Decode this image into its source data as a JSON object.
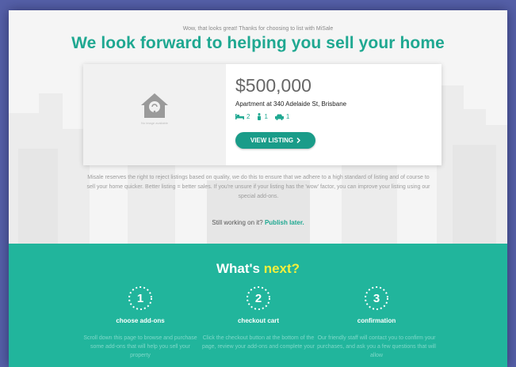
{
  "intro": "Wow, that looks great! Thanks for choosing to list with MiSale",
  "headline": "We look forward to helping you sell your home",
  "listing": {
    "image_caption": "No image available",
    "price": "$500,000",
    "address": "Apartment at 340 Adelaide St, Brisbane",
    "bedrooms": "2",
    "bathrooms": "1",
    "parking": "1",
    "view_button": "VIEW LISTING"
  },
  "disclaimer": "Misale reserves the right to reject listings based on quality, we do this to ensure that we adhere to a high standard of listing and of course to sell your home quicker. Better listing = better sales. If you're unsure if your listing has the 'wow' factor, you can improve your listing using our special add-ons.",
  "still_working": "Still working on it?",
  "publish_later": "Publish later.",
  "next": {
    "title_main": "What's",
    "title_highlight": "next?",
    "steps": [
      {
        "number": "1",
        "title": "choose add-ons",
        "desc": "Scroll down this page to browse and purchase some add-ons that will help you sell your property"
      },
      {
        "number": "2",
        "title": "checkout cart",
        "desc": "Click the checkout button at the bottom of the page, review your add-ons and complete your"
      },
      {
        "number": "3",
        "title": "confirmation",
        "desc": "Our friendly staff will contact you to confirm your purchases, and ask you a few questions that will allow"
      }
    ]
  },
  "colors": {
    "accent": "#1fa891",
    "next_bg": "#21b59c",
    "highlight": "#f4ef3c",
    "outer_bg": "#5560a8"
  },
  "icons": [
    "house-placeholder-icon",
    "bed-icon",
    "bath-icon",
    "car-icon",
    "chevron-right-icon"
  ]
}
